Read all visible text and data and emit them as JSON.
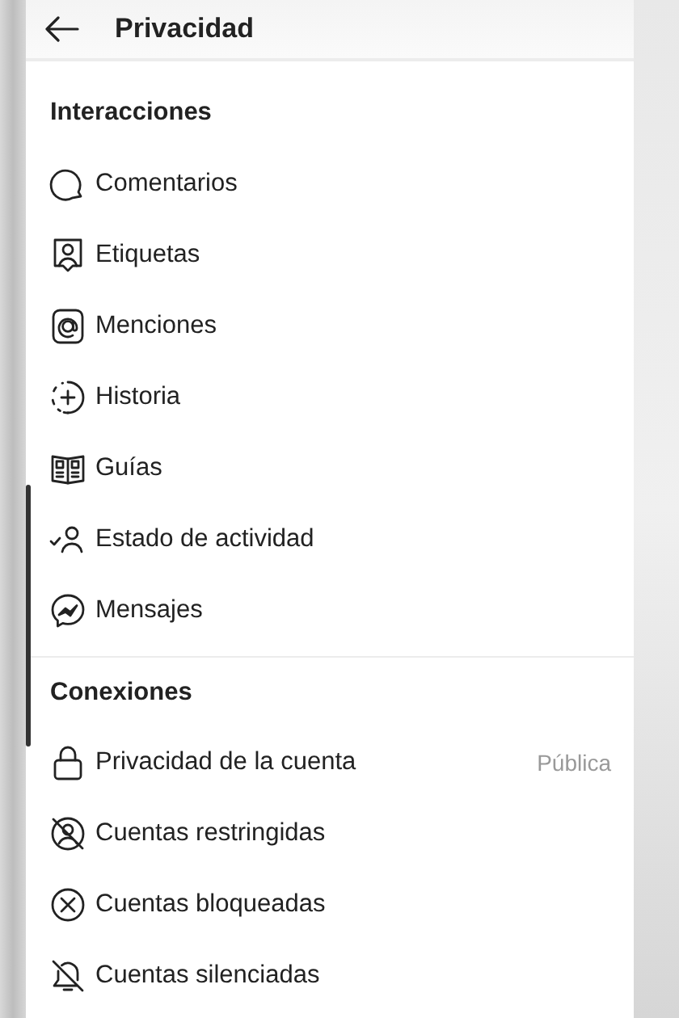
{
  "header": {
    "title": "Privacidad"
  },
  "sections": [
    {
      "title": "Interacciones",
      "items": [
        {
          "label": "Comentarios"
        },
        {
          "label": "Etiquetas"
        },
        {
          "label": "Menciones"
        },
        {
          "label": "Historia"
        },
        {
          "label": "Guías"
        },
        {
          "label": "Estado de actividad"
        },
        {
          "label": "Mensajes"
        }
      ]
    },
    {
      "title": "Conexiones",
      "items": [
        {
          "label": "Privacidad de la cuenta",
          "value": "Pública"
        },
        {
          "label": "Cuentas restringidas"
        },
        {
          "label": "Cuentas bloqueadas"
        },
        {
          "label": "Cuentas silenciadas"
        }
      ]
    }
  ]
}
